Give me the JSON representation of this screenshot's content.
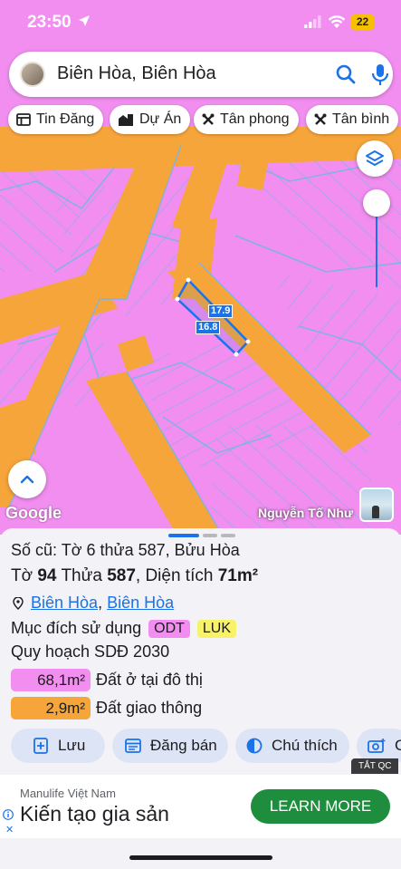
{
  "status": {
    "time": "23:50",
    "battery": "22"
  },
  "search": {
    "query": "Biên Hòa, Biên Hòa"
  },
  "chips": [
    {
      "label": "Tin Đăng",
      "icon": "list-icon"
    },
    {
      "label": "Dự Án",
      "icon": "building-icon"
    },
    {
      "label": "Tân phong",
      "icon": "tool-icon"
    },
    {
      "label": "Tân bình",
      "icon": "tool-icon"
    }
  ],
  "map": {
    "dim_a": "17.9",
    "dim_b": "16.8",
    "google": "Google",
    "attribution": "Nguyễn Tố Như",
    "colors": {
      "residential": "#f18ef0",
      "road": "#f6a53a",
      "parcel_line": "#7fb3e3",
      "accent": "#1a73e8"
    }
  },
  "parcel": {
    "old_id": "Số cũ: Tờ 6 thửa 587, Bửu Hòa",
    "sheet_label": "Tờ",
    "sheet_no": "94",
    "plot_label": "Thửa",
    "plot_no": "587",
    "area_label": "Diện tích",
    "area_value": "71m²",
    "ward": "Biên Hòa",
    "city": "Biên Hòa",
    "purpose_label": "Mục đích sử dụng",
    "purpose_tags": [
      "ODT",
      "LUK"
    ],
    "plan_label": "Quy hoạch SDĐ 2030",
    "areas": [
      {
        "value": "68,1m²",
        "label": "Đất ở tại đô thị",
        "color": "#f18ef0"
      },
      {
        "value": "2,9m²",
        "label": "Đất giao thông",
        "color": "#f6a53a"
      }
    ]
  },
  "actions": [
    {
      "label": "Lưu",
      "icon": "save-icon"
    },
    {
      "label": "Đăng bán",
      "icon": "listing-icon"
    },
    {
      "label": "Chú thích",
      "icon": "legend-icon"
    },
    {
      "label": "C",
      "icon": "camera-icon"
    }
  ],
  "ad": {
    "badge": "TẮT QC",
    "brand": "Manulife Việt Nam",
    "headline": "Kiến tạo gia sản",
    "cta": "LEARN MORE"
  }
}
